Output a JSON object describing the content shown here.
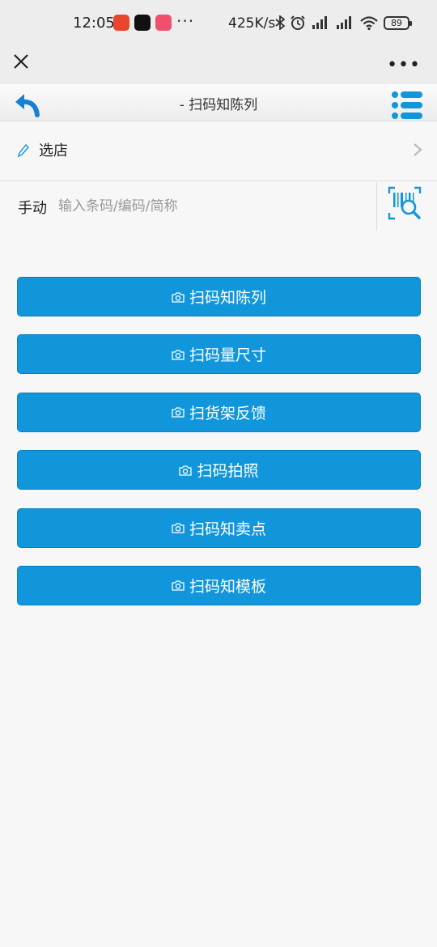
{
  "status_bar": {
    "time": "12:05",
    "more_dots": "···",
    "net_speed": "425K/s",
    "battery": "89"
  },
  "wechat_bar": {
    "more_dots": "•••"
  },
  "header": {
    "title": "- 扫码知陈列"
  },
  "store_row": {
    "label": "选店"
  },
  "manual_row": {
    "label": "手动",
    "placeholder": "输入条码/编码/简称",
    "value": ""
  },
  "actions": [
    {
      "label": "扫码知陈列"
    },
    {
      "label": "扫码量尺寸"
    },
    {
      "label": "扫货架反馈"
    },
    {
      "label": "扫码拍照"
    },
    {
      "label": "扫码知卖点"
    },
    {
      "label": "扫码知模板"
    }
  ],
  "colors": {
    "accent": "#1296db",
    "background": "#f7f7f7"
  }
}
